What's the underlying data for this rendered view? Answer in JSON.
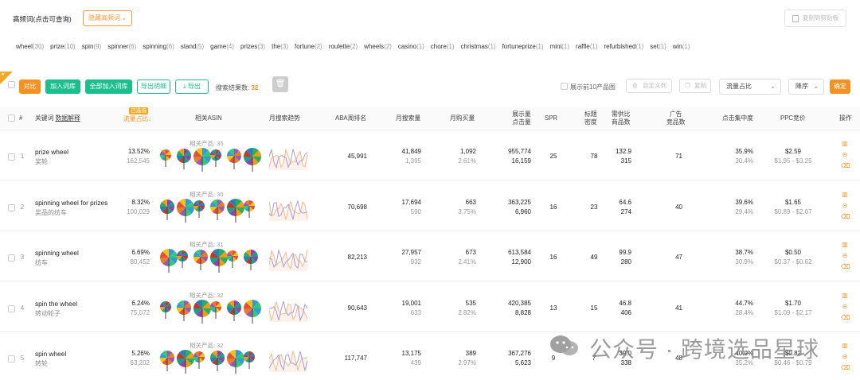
{
  "header": {
    "title": "高频词(点击可查询)",
    "filter_label": "隐藏高频词",
    "copy_label": "复制到剪贴板"
  },
  "keywords": [
    {
      "word": "wheel",
      "count": "(30)"
    },
    {
      "word": "prize",
      "count": "(10)"
    },
    {
      "word": "spin",
      "count": "(9)"
    },
    {
      "word": "spinner",
      "count": "(6)"
    },
    {
      "word": "spinning",
      "count": "(6)"
    },
    {
      "word": "stand",
      "count": "(5)"
    },
    {
      "word": "game",
      "count": "(4)"
    },
    {
      "word": "prizes",
      "count": "(3)"
    },
    {
      "word": "the",
      "count": "(3)"
    },
    {
      "word": "fortune",
      "count": "(2)"
    },
    {
      "word": "roulette",
      "count": "(2)"
    },
    {
      "word": "wheels",
      "count": "(2)"
    },
    {
      "word": "casino",
      "count": "(1)"
    },
    {
      "word": "chore",
      "count": "(1)"
    },
    {
      "word": "christmas",
      "count": "(1)"
    },
    {
      "word": "fortuneprize",
      "count": "(1)"
    },
    {
      "word": "mini",
      "count": "(1)"
    },
    {
      "word": "raffle",
      "count": "(1)"
    },
    {
      "word": "refurbished",
      "count": "(1)"
    },
    {
      "word": "set",
      "count": "(1)"
    },
    {
      "word": "win",
      "count": "(1)"
    }
  ],
  "toolbar": {
    "compare": "对比",
    "add_lib": "加入词库",
    "add_all_lib": "全部加入词库",
    "export_detail": "导出明细",
    "export": "导出",
    "result_label": "搜索结果数:",
    "result_count": "32",
    "show_top10": "展示前10产品图",
    "custom_cols": "自定义列",
    "copy": "复制",
    "sort_field": "流量占比",
    "sort_order": "降序",
    "confirm": "确定"
  },
  "columns": {
    "num": "#",
    "keyword": "关键词",
    "data_explain": "数据解释",
    "traffic_badge": "已选指标",
    "traffic": "流量占比",
    "asin": "相关ASIN",
    "trend": "月搜索趋势",
    "aba": "ABA周排名",
    "monthly_search": "月搜索量",
    "monthly_buy": "月购买量",
    "impressions_1": "展示量",
    "impressions_2": "点击量",
    "spr": "SPR",
    "title_density_1": "标题",
    "title_density_2": "密度",
    "supply_1": "需供比",
    "supply_2": "商品数",
    "ads_1": "广告",
    "ads_2": "竞品数",
    "click_conc": "点击集中度",
    "ppc": "PPC竞价",
    "actions": "操作"
  },
  "rows": [
    {
      "idx": "1",
      "kw": "prize wheel",
      "kw_cn": "奖轮",
      "share": "13.52%",
      "share_sub": "162,545",
      "asin_label": "相关产品: 35",
      "aba": "45,991",
      "search": "41,849",
      "search_sub": "1,395",
      "buy": "1,092",
      "buy_sub": "2.61%",
      "imp": "955,774",
      "clicks": "16,159",
      "spr": "25",
      "density": "78",
      "supply": "132.9",
      "goods": "315",
      "ads": "71",
      "conc": "35.9%",
      "conc_sub": "30.4%",
      "ppc": "$2.59",
      "ppc_range": "$1.95 - $3.25"
    },
    {
      "idx": "2",
      "kw": "spinning wheel for prizes",
      "kw_cn": "奖品的纺车",
      "share": "8.32%",
      "share_sub": "100,029",
      "asin_label": "相关产品: 30",
      "aba": "70,698",
      "search": "17,694",
      "search_sub": "590",
      "buy": "663",
      "buy_sub": "3.75%",
      "imp": "363,225",
      "clicks": "6,960",
      "spr": "16",
      "density": "23",
      "supply": "64.6",
      "goods": "274",
      "ads": "40",
      "conc": "39.6%",
      "conc_sub": "29.4%",
      "ppc": "$1.65",
      "ppc_range": "$0.89 - $2.07"
    },
    {
      "idx": "3",
      "kw": "spinning wheel",
      "kw_cn": "纺车",
      "share": "6.69%",
      "share_sub": "80,452",
      "asin_label": "相关产品: 31",
      "aba": "82,213",
      "search": "27,957",
      "search_sub": "932",
      "buy": "673",
      "buy_sub": "2.41%",
      "imp": "613,584",
      "clicks": "12,900",
      "spr": "16",
      "density": "49",
      "supply": "99.9",
      "goods": "280",
      "ads": "47",
      "conc": "38.7%",
      "conc_sub": "30.9%",
      "ppc": "$0.50",
      "ppc_range": "$0.37 - $0.62"
    },
    {
      "idx": "4",
      "kw": "spin the wheel",
      "kw_cn": "转动轮子",
      "share": "6.24%",
      "share_sub": "75,072",
      "asin_label": "相关产品: 32",
      "aba": "90,643",
      "search": "19,001",
      "search_sub": "633",
      "buy": "535",
      "buy_sub": "2.82%",
      "imp": "420,385",
      "clicks": "8,828",
      "spr": "13",
      "density": "15",
      "supply": "46.8",
      "goods": "406",
      "ads": "41",
      "conc": "44.7%",
      "conc_sub": "28.4%",
      "ppc": "$1.70",
      "ppc_range": "$1.09 - $2.17"
    },
    {
      "idx": "5",
      "kw": "spin wheel",
      "kw_cn": "转轮",
      "share": "5.26%",
      "share_sub": "63,202",
      "asin_label": "相关产品: 32",
      "aba": "117,747",
      "search": "13,175",
      "search_sub": "439",
      "buy": "389",
      "buy_sub": "2.97%",
      "imp": "367,276",
      "clicks": "5,623",
      "spr": "9",
      "density": "7",
      "supply": "39.0",
      "goods": "338",
      "ads": "48",
      "conc": "40.9%",
      "conc_sub": "35.2%",
      "ppc": "$0.82",
      "ppc_range": "$0.46 - $0.79"
    }
  ],
  "watermark": "公众号 · 跨境选品星球",
  "colors": {
    "accent": "#f39123",
    "green": "#1bbf8e",
    "trend_orange": "#f6b98a",
    "trend_purple": "#a99bd8"
  }
}
